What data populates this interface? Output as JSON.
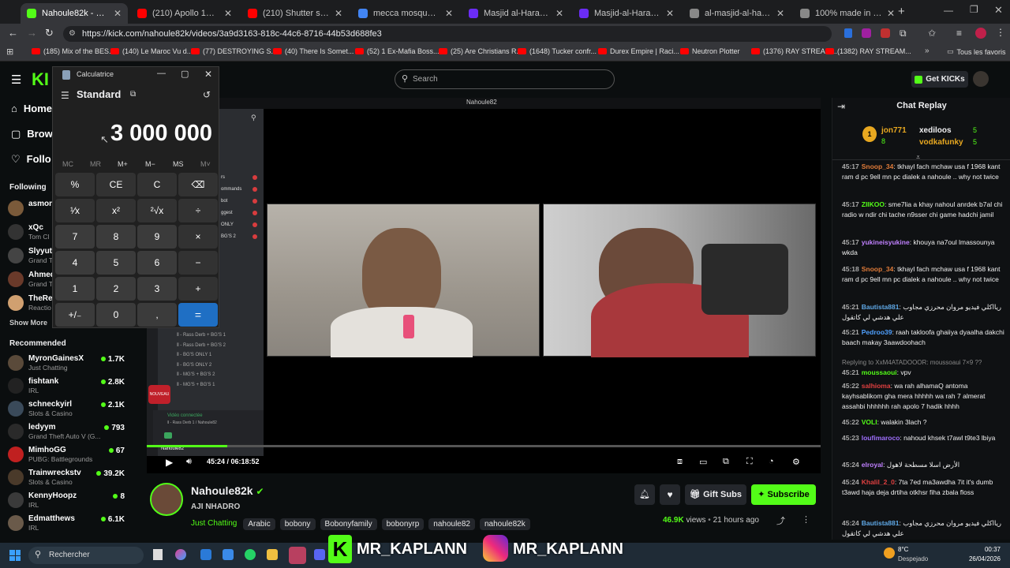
{
  "browser": {
    "tabs": [
      {
        "title": "Nahoule82k - Watch the",
        "color": "#53fc18",
        "active": true
      },
      {
        "title": "(210) Apollo 14 in 24fps",
        "color": "#ff0000"
      },
      {
        "title": "(210) Shutter speed comp",
        "color": "#ff0000"
      },
      {
        "title": "mecca mosque - Google",
        "color": "#4285f4"
      },
      {
        "title": "Masjid al-Haram (The Sac",
        "color": "#6b2cf5"
      },
      {
        "title": "Masjid-al-Haram-today-7",
        "color": "#6b2cf5"
      },
      {
        "title": "al-masjid-al-haram-788x5",
        "color": "#888888"
      },
      {
        "title": "100% made in the USA",
        "color": "#888888"
      }
    ],
    "url": "https://kick.com/nahoule82k/videos/3a9d3163-818c-44c6-8716-44b53d688fe3",
    "bookmarks": [
      "(185) Mix of the BES...",
      "(140) Le Maroc Vu d...",
      "(77) DESTROYING S...",
      "(40) There Is Somet...",
      "(52) 1 Ex-Mafia Boss...",
      "(25) Are Christians R...",
      "(1648) Tucker confr...",
      "Durex Empire | Raci...",
      "Neutron Plotter",
      "(1376) RAY STREAM...",
      "(1382) RAY STREAM..."
    ],
    "all_bookmarks": "Tous les favoris"
  },
  "kick": {
    "logo": "KI",
    "search_placeholder": "Search",
    "get_kicks": "Get KICKs",
    "nav": {
      "home": "Home",
      "browse": "Brows",
      "following": "Follo"
    },
    "following_label": "Following",
    "following": [
      {
        "name": "asmon",
        "cat": "",
        "color": "#7a5a3a"
      },
      {
        "name": "xQc",
        "cat": "Tom Cl",
        "color": "#333333"
      },
      {
        "name": "Slyyut",
        "cat": "Grand T",
        "color": "#444444"
      },
      {
        "name": "Ahmed",
        "cat": "Grand T",
        "color": "#6a3a2a"
      },
      {
        "name": "TheRe",
        "cat": "Reactio",
        "color": "#d0a070"
      }
    ],
    "show_more": "Show More",
    "recommended_label": "Recommended",
    "recommended": [
      {
        "name": "MyronGainesX",
        "cat": "Just Chatting",
        "viewers": "1.7K",
        "color": "#5a4a3a"
      },
      {
        "name": "fishtank",
        "cat": "IRL",
        "viewers": "2.8K",
        "color": "#222222"
      },
      {
        "name": "schneckyirl",
        "cat": "Slots & Casino",
        "viewers": "2.1K",
        "color": "#3a4a5a"
      },
      {
        "name": "ledyym",
        "cat": "Grand Theft Auto V (G...",
        "viewers": "793",
        "color": "#2a2a2a"
      },
      {
        "name": "MimhoGG",
        "cat": "PUBG: Battlegrounds",
        "viewers": "67",
        "color": "#c02020"
      },
      {
        "name": "Trainwreckstv",
        "cat": "Slots & Casino",
        "viewers": "39.2K",
        "color": "#4a3a2a"
      },
      {
        "name": "KennyHoopz",
        "cat": "IRL",
        "viewers": "8",
        "color": "#3a3a3a"
      },
      {
        "name": "Edmatthews",
        "cat": "IRL",
        "viewers": "6.1K",
        "color": "#6a5a4a"
      }
    ],
    "player": {
      "time": "45:24 / 06:18:52",
      "progress": 0.12,
      "discord_title": "Nahoule82",
      "discord_status": "Vidéo connectée",
      "discord_sub": "⦀ - Rass Derb 1 / Nahoule82",
      "discord_user": "Nahoule82",
      "channels": [
        "⦀ - Rass Derb + BG'S 1",
        "⦀ - Rass Derb + BG'S 2",
        "⦀ - BG'S ONLY 1",
        "⦀ - BG'S ONLY 2",
        "⦀ - MG'S + BG'S 2",
        "⦀ - MG'S + BG'S 1"
      ],
      "discord_menu": [
        "rs",
        "ommands",
        "bot",
        "ggest",
        "ONLY",
        "BG'S 2"
      ],
      "nouveau": "NOUVEAU"
    },
    "streamer": {
      "name": "Nahoule82k",
      "title": "AJI NHADRO",
      "category": "Just Chatting",
      "tags": [
        "Arabic",
        "bobony",
        "Bobonyfamily",
        "bobonyrp",
        "nahoule82",
        "nahoule82k"
      ],
      "views_num": "46.9K",
      "views_label": "views",
      "ago": "21 hours ago",
      "gift_subs": "Gift Subs",
      "subscribe": "Subscribe"
    },
    "chat": {
      "title": "Chat Replay",
      "gifters": [
        {
          "name": "jon771",
          "count": "8"
        },
        {
          "name": "xediloos",
          "count": "5"
        },
        {
          "name": "vodkafunky",
          "count": "5"
        }
      ],
      "messages": [
        {
          "time": "45:17",
          "user": "Snoop_34",
          "color": "#e07b39",
          "text": "tkhayl fach mchaw usa f 1968 kant ram d pc 9ell mn pc dialek a nahoule .. why not twice"
        },
        {
          "time": "45:17",
          "user": "ZIIKOO",
          "color": "#53fc18",
          "text": "sme7lia a khay nahoul anrdek b7al chi radio w ndir chi tache n9sser chi game hadchi jamil"
        },
        {
          "time": "45:17",
          "user": "yukineisyukine",
          "color": "#c080ff",
          "text": "khouya na7oul lmassounya wkda"
        },
        {
          "time": "45:18",
          "user": "Snoop_34",
          "color": "#e07b39",
          "text": "tkhayl fach mchaw usa f 1968 kant ram d pc 9ell mn pc dialek a nahoule .. why not twice"
        },
        {
          "time": "45:21",
          "user": "Bautista881",
          "color": "#5fa8e6",
          "text": "ريااكلي فيديو مروان محرزي مجاوب علي هدشي لي كاتقول"
        },
        {
          "time": "45:21",
          "user": "Pedroo39",
          "color": "#4fa0ff",
          "text": "raah takloofa ghaiiya dyaalha dakchi baach makay 3aawdoohach"
        },
        {
          "time": "45:21",
          "user": "moussaoui",
          "color": "#53fc18",
          "text": "vpv",
          "reply": "Replying to XxM4ATADOOOR: moussoaui 7×9 ??"
        },
        {
          "time": "45:22",
          "user": "salhioma",
          "color": "#e04040",
          "text": "wa rah alhamaQ antoma kayhsablikom gha mera hhhhh wa rah 7 almerat assahbi hhhhhh rah apolo 7 hadik hhhh"
        },
        {
          "time": "45:22",
          "user": "VOLI",
          "color": "#53fc18",
          "text": "walakin 3lach ?"
        },
        {
          "time": "45:23",
          "user": "loufimaroco",
          "color": "#a070ff",
          "text": "nahoud khsek t7awl t9te3 lbiya"
        },
        {
          "time": "45:24",
          "user": "elroyal",
          "color": "#c080ff",
          "text": "الأرض اسلا مسطحة لاهول"
        },
        {
          "time": "45:24",
          "user": "Khalil_2_0",
          "color": "#e04040",
          "text": "7ta 7ed ma3awdha 7it it's dumb t3awd haja deja drtiha otkhsr fiha zbala floss"
        },
        {
          "time": "45:24",
          "user": "Bautista881",
          "color": "#5fa8e6",
          "text": "ريااكلي فيديو مروان محرزي مجاوب علي هدشي لي كاتقول"
        }
      ]
    }
  },
  "calculator": {
    "title": "Calculatrice",
    "mode": "Standard",
    "display": "3 000 000",
    "memory": [
      "MC",
      "MR",
      "M+",
      "M−",
      "MS",
      "M˅"
    ],
    "keys": [
      [
        "%",
        "CE",
        "C",
        "⌫"
      ],
      [
        "¹⁄x",
        "x²",
        "²√x",
        "÷"
      ],
      [
        "7",
        "8",
        "9",
        "×"
      ],
      [
        "4",
        "5",
        "6",
        "−"
      ],
      [
        "1",
        "2",
        "3",
        "+"
      ],
      [
        "+/₋",
        "0",
        ",",
        "="
      ]
    ]
  },
  "overlay": {
    "text1": "MR_KAPLANN",
    "text2": "MR_KAPLANN"
  },
  "taskbar": {
    "search": "Rechercher",
    "weather_temp": "8°C",
    "weather_desc": "Despejado",
    "time": "00:37",
    "date": "26/04/2026"
  }
}
